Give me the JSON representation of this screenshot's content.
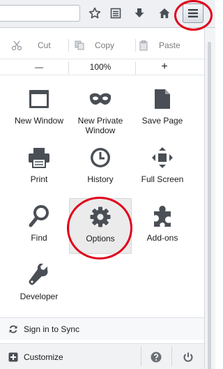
{
  "edit": {
    "cut": "Cut",
    "copy": "Copy",
    "paste": "Paste"
  },
  "zoom": {
    "out": "—",
    "level": "100%",
    "in": "+"
  },
  "panel": {
    "items": [
      {
        "label": "New Window"
      },
      {
        "label": "New Private Window"
      },
      {
        "label": "Save Page"
      },
      {
        "label": "Print"
      },
      {
        "label": "History"
      },
      {
        "label": "Full Screen"
      },
      {
        "label": "Find"
      },
      {
        "label": "Options"
      },
      {
        "label": "Add-ons"
      },
      {
        "label": "Developer"
      }
    ]
  },
  "footer": {
    "sync": "Sign in to Sync",
    "customize": "Customize"
  },
  "colors": {
    "highlight_ring": "#e0001b",
    "icon": "#4a4f56"
  }
}
